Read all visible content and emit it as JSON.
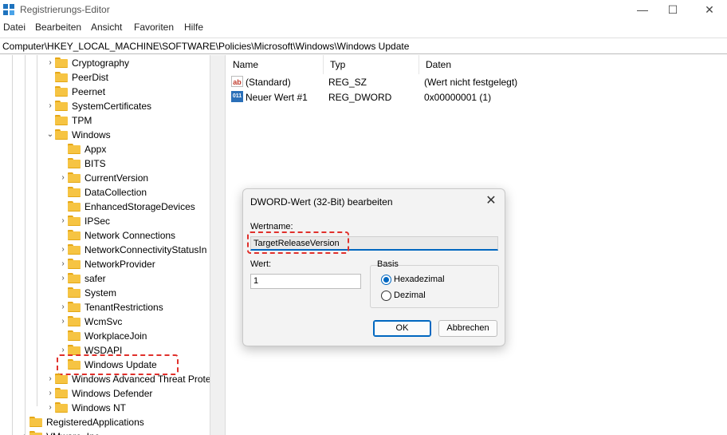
{
  "window": {
    "title": "Registrierungs-Editor",
    "minimize_glyph": "—",
    "maximize_glyph": "☐",
    "close_glyph": "✕",
    "app_icon": "registry-editor-icon",
    "accent_color": "#0067c0"
  },
  "menu": [
    "Datei",
    "Bearbeiten",
    "Ansicht",
    "Favoriten",
    "Hilfe"
  ],
  "address": "Computer\\HKEY_LOCAL_MACHINE\\SOFTWARE\\Policies\\Microsoft\\Windows\\Windows Update",
  "tree": [
    {
      "label": "Cryptography",
      "expander": "›"
    },
    {
      "label": "PeerDist",
      "expander": ""
    },
    {
      "label": "Peernet",
      "expander": ""
    },
    {
      "label": "SystemCertificates",
      "expander": "›"
    },
    {
      "label": "TPM",
      "expander": ""
    },
    {
      "label": "Windows",
      "expander": "⌄"
    },
    {
      "label": "Appx",
      "expander": ""
    },
    {
      "label": "BITS",
      "expander": ""
    },
    {
      "label": "CurrentVersion",
      "expander": "›"
    },
    {
      "label": "DataCollection",
      "expander": ""
    },
    {
      "label": "EnhancedStorageDevices",
      "expander": ""
    },
    {
      "label": "IPSec",
      "expander": "›"
    },
    {
      "label": "Network Connections",
      "expander": ""
    },
    {
      "label": "NetworkConnectivityStatusIn",
      "expander": "›"
    },
    {
      "label": "NetworkProvider",
      "expander": "›"
    },
    {
      "label": "safer",
      "expander": "›"
    },
    {
      "label": "System",
      "expander": ""
    },
    {
      "label": "TenantRestrictions",
      "expander": "›"
    },
    {
      "label": "WcmSvc",
      "expander": "›"
    },
    {
      "label": "WorkplaceJoin",
      "expander": ""
    },
    {
      "label": "WSDAPI",
      "expander": "›"
    },
    {
      "label": "Windows Update",
      "expander": ""
    },
    {
      "label": "Windows Advanced Threat Prote",
      "expander": "›"
    },
    {
      "label": "Windows Defender",
      "expander": "›"
    },
    {
      "label": "Windows NT",
      "expander": "›"
    },
    {
      "label": "RegisteredApplications",
      "expander": ""
    },
    {
      "label": "VMware, Inc.",
      "expander": "›"
    }
  ],
  "list": {
    "columns": [
      "Name",
      "Typ",
      "Daten"
    ],
    "rows": [
      {
        "icon": "ab",
        "name": "(Standard)",
        "type": "REG_SZ",
        "data": "(Wert nicht festgelegt)"
      },
      {
        "icon": "011",
        "name": "Neuer Wert #1",
        "type": "REG_DWORD",
        "data": "0x00000001 (1)"
      }
    ]
  },
  "dialog": {
    "title": "DWORD-Wert (32-Bit) bearbeiten",
    "close_glyph": "✕",
    "value_name_label": "Wertname:",
    "value_name": "TargetReleaseVersion",
    "value_label": "Wert:",
    "value": "1",
    "basis_label": "Basis",
    "basis_options": [
      {
        "label": "Hexadezimal",
        "selected": true
      },
      {
        "label": "Dezimal",
        "selected": false
      }
    ],
    "ok_label": "OK",
    "cancel_label": "Abbrechen"
  },
  "highlight_color": "#e0302b"
}
